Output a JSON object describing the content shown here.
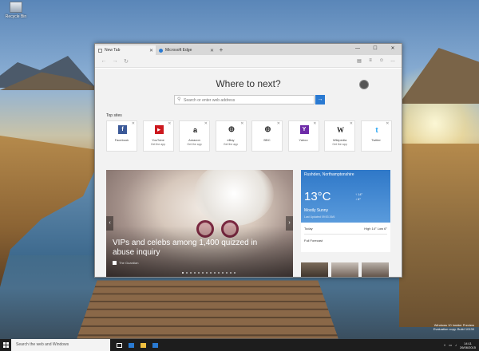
{
  "desktop": {
    "icon_label": "Recycle Bin",
    "watermark": [
      "Windows 10 Insider Preview",
      "Evaluation copy. Build 10130"
    ]
  },
  "browser": {
    "tabs": [
      {
        "label": "New Tab",
        "active": true
      },
      {
        "label": "Microsoft Edge",
        "active": false
      }
    ],
    "new_tab_symbol": "+",
    "window_controls": [
      "—",
      "☐",
      "✕"
    ],
    "nav": {
      "back": "←",
      "forward": "→",
      "refresh": "↻"
    },
    "toolbar_icons": [
      "reading-view",
      "hub",
      "feedback",
      "more"
    ]
  },
  "newtab": {
    "heading": "Where to next?",
    "search_placeholder": "Search or enter web address",
    "search_button": "→",
    "top_sites_label": "Top sites",
    "tiles": [
      {
        "name": "Facebook",
        "sub": "",
        "glyph": "f",
        "color": "#3b5998"
      },
      {
        "name": "YouTube",
        "sub": "Get the app",
        "glyph": "▶",
        "color": "#cc181e"
      },
      {
        "name": "Amazon",
        "sub": "Get the app",
        "glyph": "a",
        "color": "#ffffff"
      },
      {
        "name": "eBay",
        "sub": "Get the app",
        "glyph": "⊕",
        "color": "#ffffff"
      },
      {
        "name": "BBC",
        "sub": "",
        "glyph": "⊕",
        "color": "#ffffff"
      },
      {
        "name": "Yahoo",
        "sub": "",
        "glyph": "Y",
        "color": "#6e2ba8"
      },
      {
        "name": "Wikipedia",
        "sub": "Get the app",
        "glyph": "W",
        "color": "#ffffff"
      },
      {
        "name": "Twitter",
        "sub": "",
        "glyph": "t",
        "color": "#1da1f2"
      }
    ],
    "news": {
      "headline": "VIPs and celebs among 1,400 quizzed in abuse inquiry",
      "source": "The Guardian"
    },
    "weather": {
      "location": "Rushden, Northamptonshire",
      "temp": "13°C",
      "high": "↑ 14°",
      "low": "↓ 6°",
      "condition": "Mostly Sunny",
      "updated": "Last Updated 09:53 26/6",
      "today_label": "Today",
      "today_value": "High 14° Low 6°",
      "forecast_label": "Full Forecast"
    }
  },
  "taskbar": {
    "search_placeholder": "Search the web and Windows",
    "time": "14:11",
    "date": "26/06/2015"
  }
}
